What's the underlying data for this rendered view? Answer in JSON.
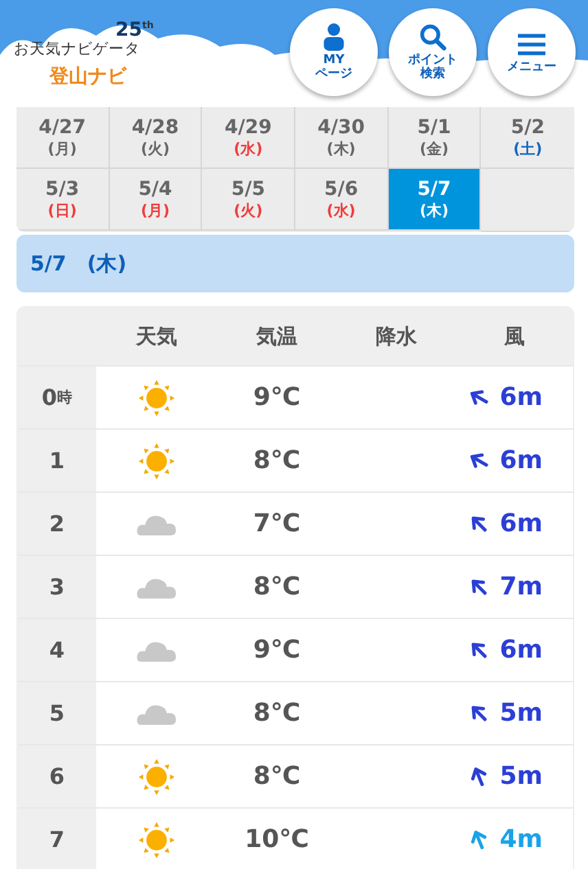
{
  "header": {
    "logo_anniversary": "25",
    "logo_anniversary_suffix": "th",
    "logo_title": "お天気ナビゲータ",
    "logo_subtitle": "登山ナビ",
    "buttons": [
      {
        "kind": "person",
        "label_lines": [
          "MY",
          "ページ"
        ]
      },
      {
        "kind": "search",
        "label_lines": [
          "ポイント",
          "検索"
        ]
      },
      {
        "kind": "menu",
        "label_lines": [
          "メニュー"
        ]
      }
    ]
  },
  "dates": [
    {
      "date": "4/27",
      "weekday": "(月)",
      "color": "#666666",
      "selected": false
    },
    {
      "date": "4/28",
      "weekday": "(火)",
      "color": "#666666",
      "selected": false
    },
    {
      "date": "4/29",
      "weekday": "(水)",
      "color": "#f03c3c",
      "selected": false
    },
    {
      "date": "4/30",
      "weekday": "(木)",
      "color": "#666666",
      "selected": false
    },
    {
      "date": "5/1",
      "weekday": "(金)",
      "color": "#666666",
      "selected": false
    },
    {
      "date": "5/2",
      "weekday": "(土)",
      "color": "#1565c0",
      "selected": false
    },
    {
      "date": "5/3",
      "weekday": "(日)",
      "color": "#f03c3c",
      "selected": false
    },
    {
      "date": "5/4",
      "weekday": "(月)",
      "color": "#f03c3c",
      "selected": false
    },
    {
      "date": "5/5",
      "weekday": "(火)",
      "color": "#f03c3c",
      "selected": false
    },
    {
      "date": "5/6",
      "weekday": "(水)",
      "color": "#f03c3c",
      "selected": false
    },
    {
      "date": "5/7",
      "weekday": "(木)",
      "selected": true
    }
  ],
  "selected_day": {
    "date": "5/7",
    "weekday": "(木)"
  },
  "table": {
    "columns": [
      "天気",
      "気温",
      "降水",
      "風"
    ],
    "hour_unit": "時",
    "rows": [
      {
        "hour": "0",
        "kind": "sunny",
        "temp": "9℃",
        "wind": {
          "speed": "6m",
          "kind": "wnw",
          "color": "#2b3fd6"
        }
      },
      {
        "hour": "1",
        "kind": "sunny",
        "temp": "8℃",
        "wind": {
          "speed": "6m",
          "kind": "wnw",
          "color": "#2b3fd6"
        }
      },
      {
        "hour": "2",
        "kind": "cloudy",
        "temp": "7℃",
        "wind": {
          "speed": "6m",
          "kind": "nw",
          "color": "#2b3fd6"
        }
      },
      {
        "hour": "3",
        "kind": "cloudy",
        "temp": "8℃",
        "wind": {
          "speed": "7m",
          "kind": "nw",
          "color": "#2b3fd6"
        }
      },
      {
        "hour": "4",
        "kind": "cloudy",
        "temp": "9℃",
        "wind": {
          "speed": "6m",
          "kind": "nw",
          "color": "#2b3fd6"
        }
      },
      {
        "hour": "5",
        "kind": "cloudy",
        "temp": "8℃",
        "wind": {
          "speed": "5m",
          "kind": "nw",
          "color": "#2b3fd6"
        }
      },
      {
        "hour": "6",
        "kind": "sunny",
        "temp": "8℃",
        "wind": {
          "speed": "5m",
          "kind": "nnw",
          "color": "#2b3fd6"
        }
      },
      {
        "hour": "7",
        "kind": "sunny",
        "temp": "10℃",
        "wind": {
          "speed": "4m",
          "kind": "nnw",
          "color": "#1aa3e8"
        }
      }
    ]
  }
}
